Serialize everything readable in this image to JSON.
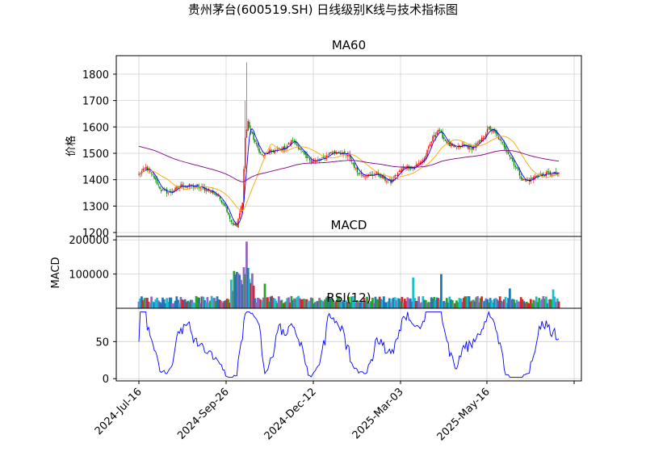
{
  "chart_data": {
    "title": "贵州茅台(600519.SH) 日线级别K线与技术指标图",
    "panels": [
      {
        "type": "candlestick",
        "title": "MA60",
        "ylabel": "价格",
        "ylim": [
          1185,
          1870
        ],
        "yticks": [
          1200,
          1300,
          1400,
          1500,
          1600,
          1700,
          1800
        ],
        "anchors_close": [
          [
            0,
            1420
          ],
          [
            5,
            1445
          ],
          [
            10,
            1415
          ],
          [
            16,
            1360
          ],
          [
            22,
            1350
          ],
          [
            30,
            1378
          ],
          [
            40,
            1375
          ],
          [
            50,
            1360
          ],
          [
            56,
            1340
          ],
          [
            62,
            1300
          ],
          [
            66,
            1240
          ],
          [
            70,
            1222
          ],
          [
            74,
            1320
          ],
          [
            76,
            1560
          ],
          [
            78,
            1620
          ],
          [
            80,
            1580
          ],
          [
            84,
            1530
          ],
          [
            88,
            1490
          ],
          [
            92,
            1505
          ],
          [
            98,
            1510
          ],
          [
            104,
            1520
          ],
          [
            110,
            1550
          ],
          [
            116,
            1510
          ],
          [
            120,
            1480
          ],
          [
            126,
            1470
          ],
          [
            132,
            1480
          ],
          [
            136,
            1500
          ],
          [
            142,
            1505
          ],
          [
            150,
            1490
          ],
          [
            156,
            1430
          ],
          [
            160,
            1420
          ],
          [
            166,
            1415
          ],
          [
            170,
            1425
          ],
          [
            176,
            1400
          ],
          [
            180,
            1390
          ],
          [
            184,
            1420
          ],
          [
            190,
            1450
          ],
          [
            196,
            1445
          ],
          [
            204,
            1480
          ],
          [
            210,
            1560
          ],
          [
            214,
            1590
          ],
          [
            218,
            1555
          ],
          [
            222,
            1530
          ],
          [
            226,
            1520
          ],
          [
            232,
            1530
          ],
          [
            238,
            1520
          ],
          [
            244,
            1545
          ],
          [
            250,
            1595
          ],
          [
            254,
            1580
          ],
          [
            258,
            1550
          ],
          [
            262,
            1520
          ],
          [
            266,
            1480
          ],
          [
            270,
            1440
          ],
          [
            274,
            1400
          ],
          [
            278,
            1395
          ],
          [
            284,
            1415
          ],
          [
            290,
            1420
          ],
          [
            296,
            1425
          ],
          [
            300,
            1420
          ]
        ],
        "series_ma": [
          {
            "color": "#0000ff",
            "period": 5
          },
          {
            "color": "#ffa500",
            "period": 20
          },
          {
            "color": "#800080",
            "period": 60,
            "start_value": 1527
          }
        ],
        "candle_colors": {
          "up": "#ff0000",
          "down": "#008000"
        }
      },
      {
        "type": "bar",
        "title": "MACD",
        "ylabel": "MACD",
        "ylim": [
          0,
          210000
        ],
        "yticks": [
          100000,
          200000
        ],
        "max_value": 195000,
        "colors": [
          "#1f77b4",
          "#2ca02c",
          "#d62728",
          "#9467bd",
          "#17becf"
        ]
      },
      {
        "type": "line",
        "title": "RSI(12)",
        "ylim": [
          -3,
          95
        ],
        "yticks": [
          0,
          50
        ],
        "color": "#0000ff"
      }
    ],
    "xticks": [
      "2024-Jul-16",
      "2024-Sep-26",
      "2024-Dec-12",
      "2025-Mar-03",
      "2025-May-16"
    ],
    "grid": true,
    "n_days": 301
  }
}
